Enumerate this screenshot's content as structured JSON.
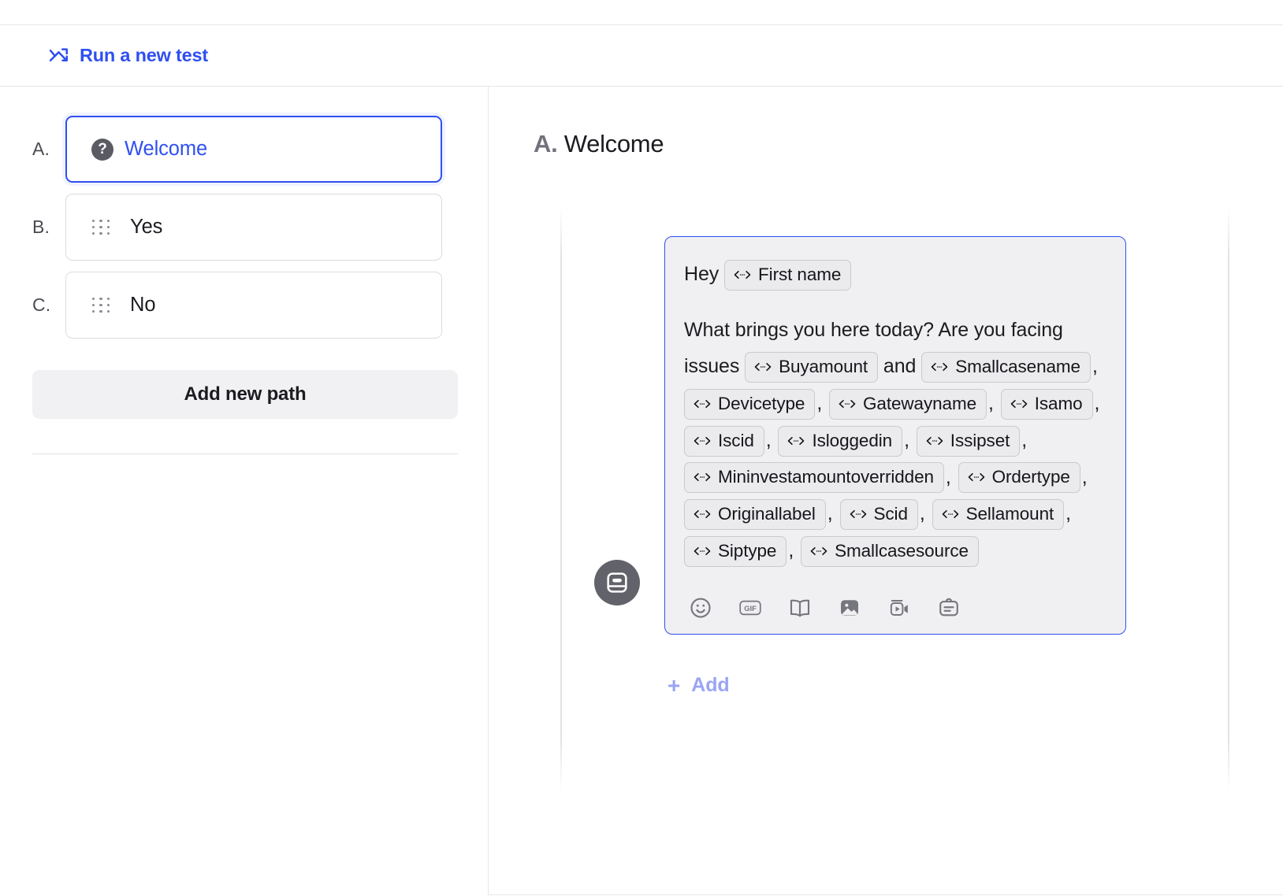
{
  "header": {
    "run_test_label": "Run a new test",
    "run_test_icon": "trend-shuffle-icon",
    "accent_color": "#2f4ff1"
  },
  "sidebar": {
    "paths": [
      {
        "letter": "A.",
        "label": "Welcome",
        "icon": "question-mark-icon",
        "active": true
      },
      {
        "letter": "B.",
        "label": "Yes",
        "icon": "drag-handle-icon",
        "active": false
      },
      {
        "letter": "C.",
        "label": "No",
        "icon": "drag-handle-icon",
        "active": false
      }
    ],
    "add_path_label": "Add new path"
  },
  "main": {
    "title_prefix": "A.",
    "title": "Welcome",
    "avatar_icon": "chat-card-icon",
    "message": {
      "greeting": "Hey",
      "greeting_chip": "First name",
      "paragraph_start": "What brings you here today? Are you facing issues",
      "paragraph_mid": "and",
      "chips": [
        "Buyamount",
        "Smallcasename",
        "Devicetype",
        "Gatewayname",
        "Isamo",
        "Iscid",
        "Isloggedin",
        "Issipset",
        "Mininvestamountoverridden",
        "Ordertype",
        "Originallabel",
        "Scid",
        "Sellamount",
        "Siptype",
        "Smallcasesource"
      ],
      "chip_icon": "variable-tag-icon",
      "separator": ","
    },
    "toolbar": [
      {
        "name": "emoji-icon",
        "title": "Emoji"
      },
      {
        "name": "gif-icon",
        "title": "GIF"
      },
      {
        "name": "article-icon",
        "title": "Article"
      },
      {
        "name": "image-icon",
        "title": "Image"
      },
      {
        "name": "video-icon",
        "title": "Video"
      },
      {
        "name": "form-icon",
        "title": "Form"
      }
    ],
    "add_label": "Add",
    "add_plus": "+"
  }
}
